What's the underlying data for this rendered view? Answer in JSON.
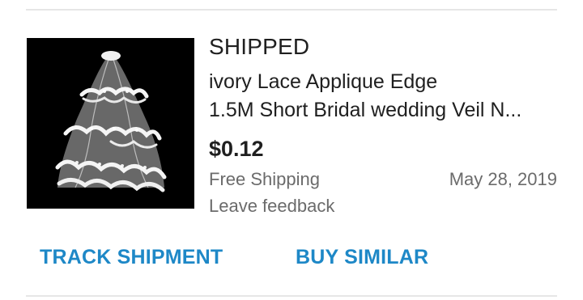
{
  "order": {
    "status": "SHIPPED",
    "title_line1": "ivory Lace Applique Edge",
    "title_line2": "1.5M Short Bridal wedding Veil N...",
    "price": "$0.12",
    "shipping": "Free Shipping",
    "date": "May 28, 2019",
    "feedback": "Leave feedback",
    "image_icon": "bridal-veil-product-image"
  },
  "actions": {
    "track_label": "TRACK SHIPMENT",
    "similar_label": "BUY SIMILAR"
  },
  "colors": {
    "action_blue": "#1e88c7",
    "text_primary": "#1f1f1f",
    "text_secondary": "#6b6b6b",
    "divider": "#e6e6e6"
  }
}
